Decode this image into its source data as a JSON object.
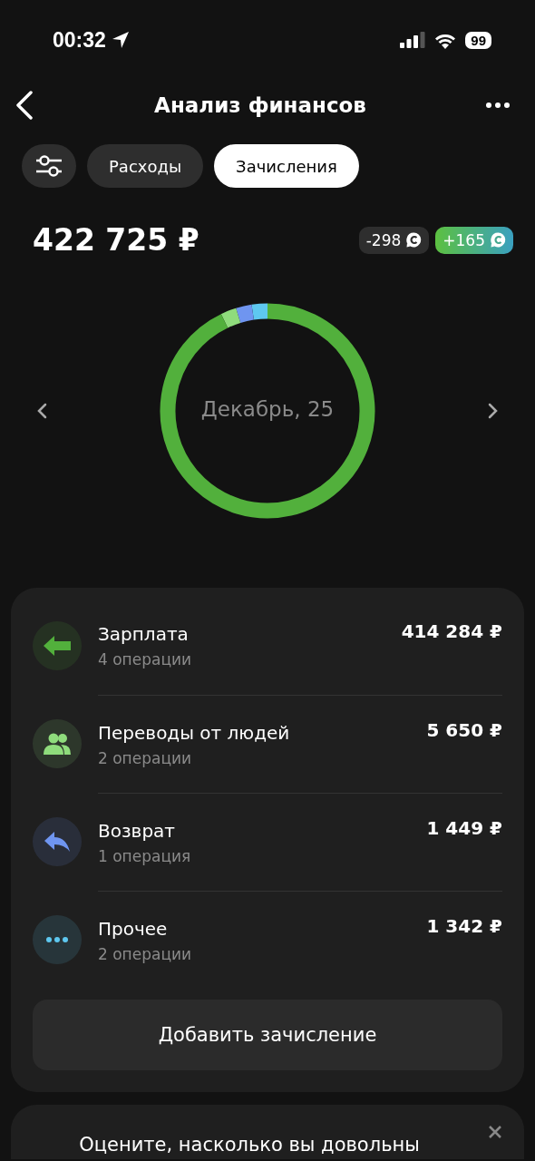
{
  "status_bar": {
    "time": "00:32",
    "battery": "99"
  },
  "header": {
    "title": "Анализ финансов"
  },
  "tabs": [
    {
      "label": "Расходы",
      "selected": false
    },
    {
      "label": "Зачисления",
      "selected": true
    }
  ],
  "total": "422 725 ₽",
  "badges": [
    {
      "kind": "spent",
      "text": "-298"
    },
    {
      "kind": "earned",
      "text": "+165"
    }
  ],
  "period": "Декабрь, 25",
  "categories": [
    {
      "kind": "salary",
      "name": "Зарплата",
      "count": "4 операции",
      "amount": "414 284 ₽",
      "color": "#52b03c"
    },
    {
      "kind": "people",
      "name": "Переводы от людей",
      "count": "2 операции",
      "amount": "5 650 ₽",
      "color": "#8fdc7c"
    },
    {
      "kind": "refund",
      "name": "Возврат",
      "count": "1 операция",
      "amount": "1 449 ₽",
      "color": "#6f95f0"
    },
    {
      "kind": "other",
      "name": "Прочее",
      "count": "2 операции",
      "amount": "1 342 ₽",
      "color": "#5ec8f0"
    }
  ],
  "add_button": "Добавить зачисление",
  "survey": {
    "text": "Оцените, насколько вы довольны"
  }
}
